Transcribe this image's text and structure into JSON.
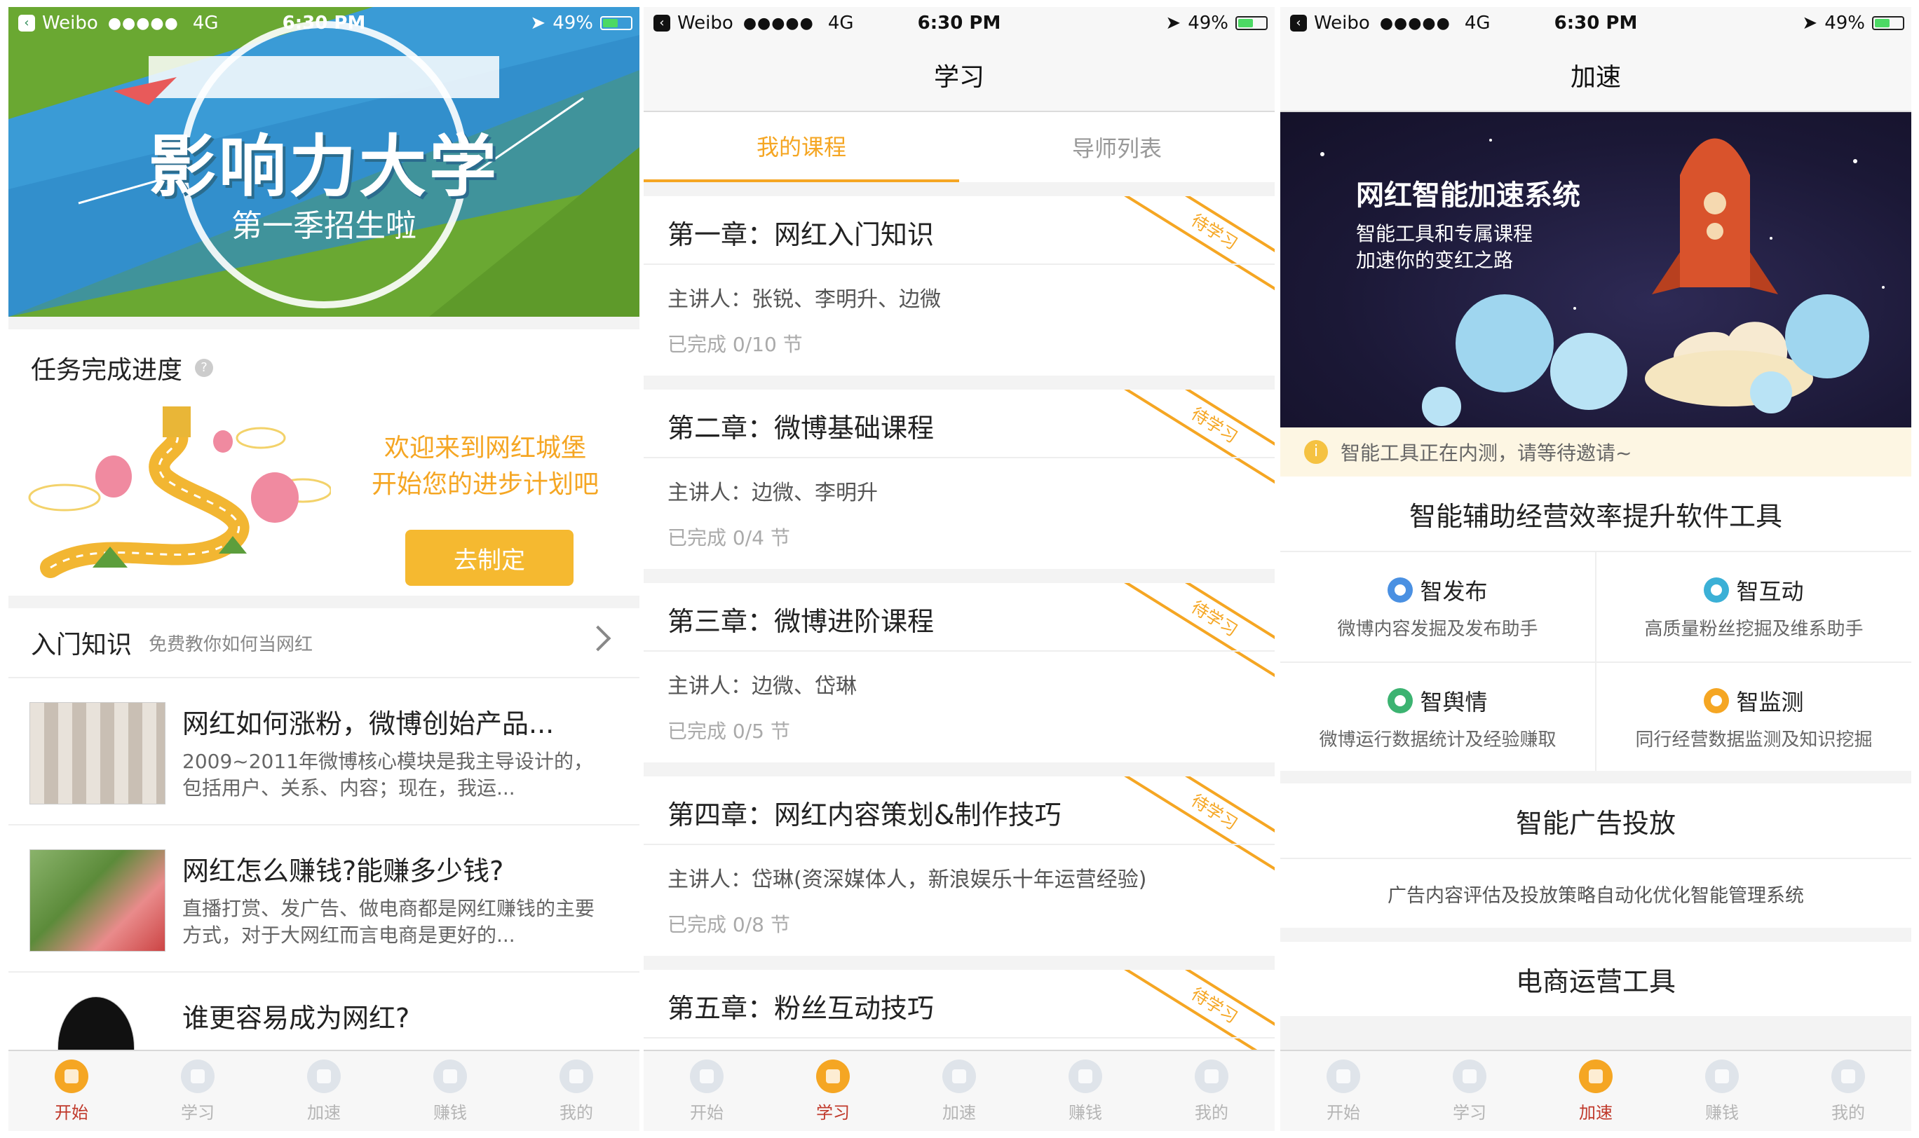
{
  "status_bar": {
    "carrier": "Weibo",
    "signal": "●●●●●",
    "network": "4G",
    "time": "6:30 PM",
    "battery": "49%",
    "battery_level": 0.49
  },
  "tabs": [
    "开始",
    "学习",
    "加速",
    "赚钱",
    "我的"
  ],
  "screen1": {
    "banner_title": "影响力大学",
    "banner_subtitle": "第一季招生啦",
    "task_section_title": "任务完成进度",
    "help_mark": "?",
    "welcome_line1": "欢迎来到网红城堡",
    "welcome_line2": "开始您的进步计划吧",
    "plan_button": "去制定",
    "intro_title": "入门知识",
    "intro_subtitle": "免费教你如何当网红",
    "articles": [
      {
        "title": "网红如何涨粉，微博创始产品...",
        "desc": "2009~2011年微博核心模块是我主导设计的，包括用户、关系、内容；现在，我运..."
      },
      {
        "title": "网红怎么赚钱?能赚多少钱?",
        "desc": "直播打赏、发广告、做电商都是网红赚钱的主要方式，对于大网红而言电商是更好的..."
      },
      {
        "title": "谁更容易成为网红?",
        "desc": ""
      }
    ],
    "active_tab": 0
  },
  "screen2": {
    "nav_title": "学习",
    "segments": [
      "我的课程",
      "导师列表"
    ],
    "ribbon_label": "待学习",
    "chapters": [
      {
        "title": "第一章：网红入门知识",
        "lecturers": "主讲人：张锐、李明升、边微",
        "progress": "已完成 0/10 节"
      },
      {
        "title": "第二章：微博基础课程",
        "lecturers": "主讲人：边微、李明升",
        "progress": "已完成 0/4 节"
      },
      {
        "title": "第三章：微博进阶课程",
        "lecturers": "主讲人：边微、岱琳",
        "progress": "已完成 0/5 节"
      },
      {
        "title": "第四章：网红内容策划&制作技巧",
        "lecturers": "主讲人：岱琳(资深媒体人，新浪娱乐十年运营经验)",
        "progress": "已完成 0/8 节"
      },
      {
        "title": "第五章：粉丝互动技巧",
        "lecturers": "",
        "progress": ""
      }
    ],
    "active_tab": 1
  },
  "screen3": {
    "nav_title": "加速",
    "banner_title": "网红智能加速系统",
    "banner_line1": "智能工具和专属课程",
    "banner_line2": "加速你的变红之路",
    "notice_icon": "i",
    "notice": "智能工具正在内测，请等待邀请~",
    "tools_title": "智能辅助经营效率提升软件工具",
    "tools": [
      {
        "name": "智发布",
        "desc": "微博内容发掘及发布助手",
        "color": "#4a90e2"
      },
      {
        "name": "智互动",
        "desc": "高质量粉丝挖掘及维系助手",
        "color": "#3bb0d6"
      },
      {
        "name": "智舆情",
        "desc": "微博运行数据统计及经验赚取",
        "color": "#3cb371"
      },
      {
        "name": "智监测",
        "desc": "同行经营数据监测及知识挖掘",
        "color": "#f5a623"
      }
    ],
    "ads_title": "智能广告投放",
    "ads_desc": "广告内容评估及投放策略自动化优化智能管理系统",
    "ecom_title": "电商运营工具",
    "active_tab": 2
  },
  "colors": {
    "accent": "#f5a623",
    "active_tab_text": "#c0392b",
    "banner_green": "#3aa34b"
  }
}
